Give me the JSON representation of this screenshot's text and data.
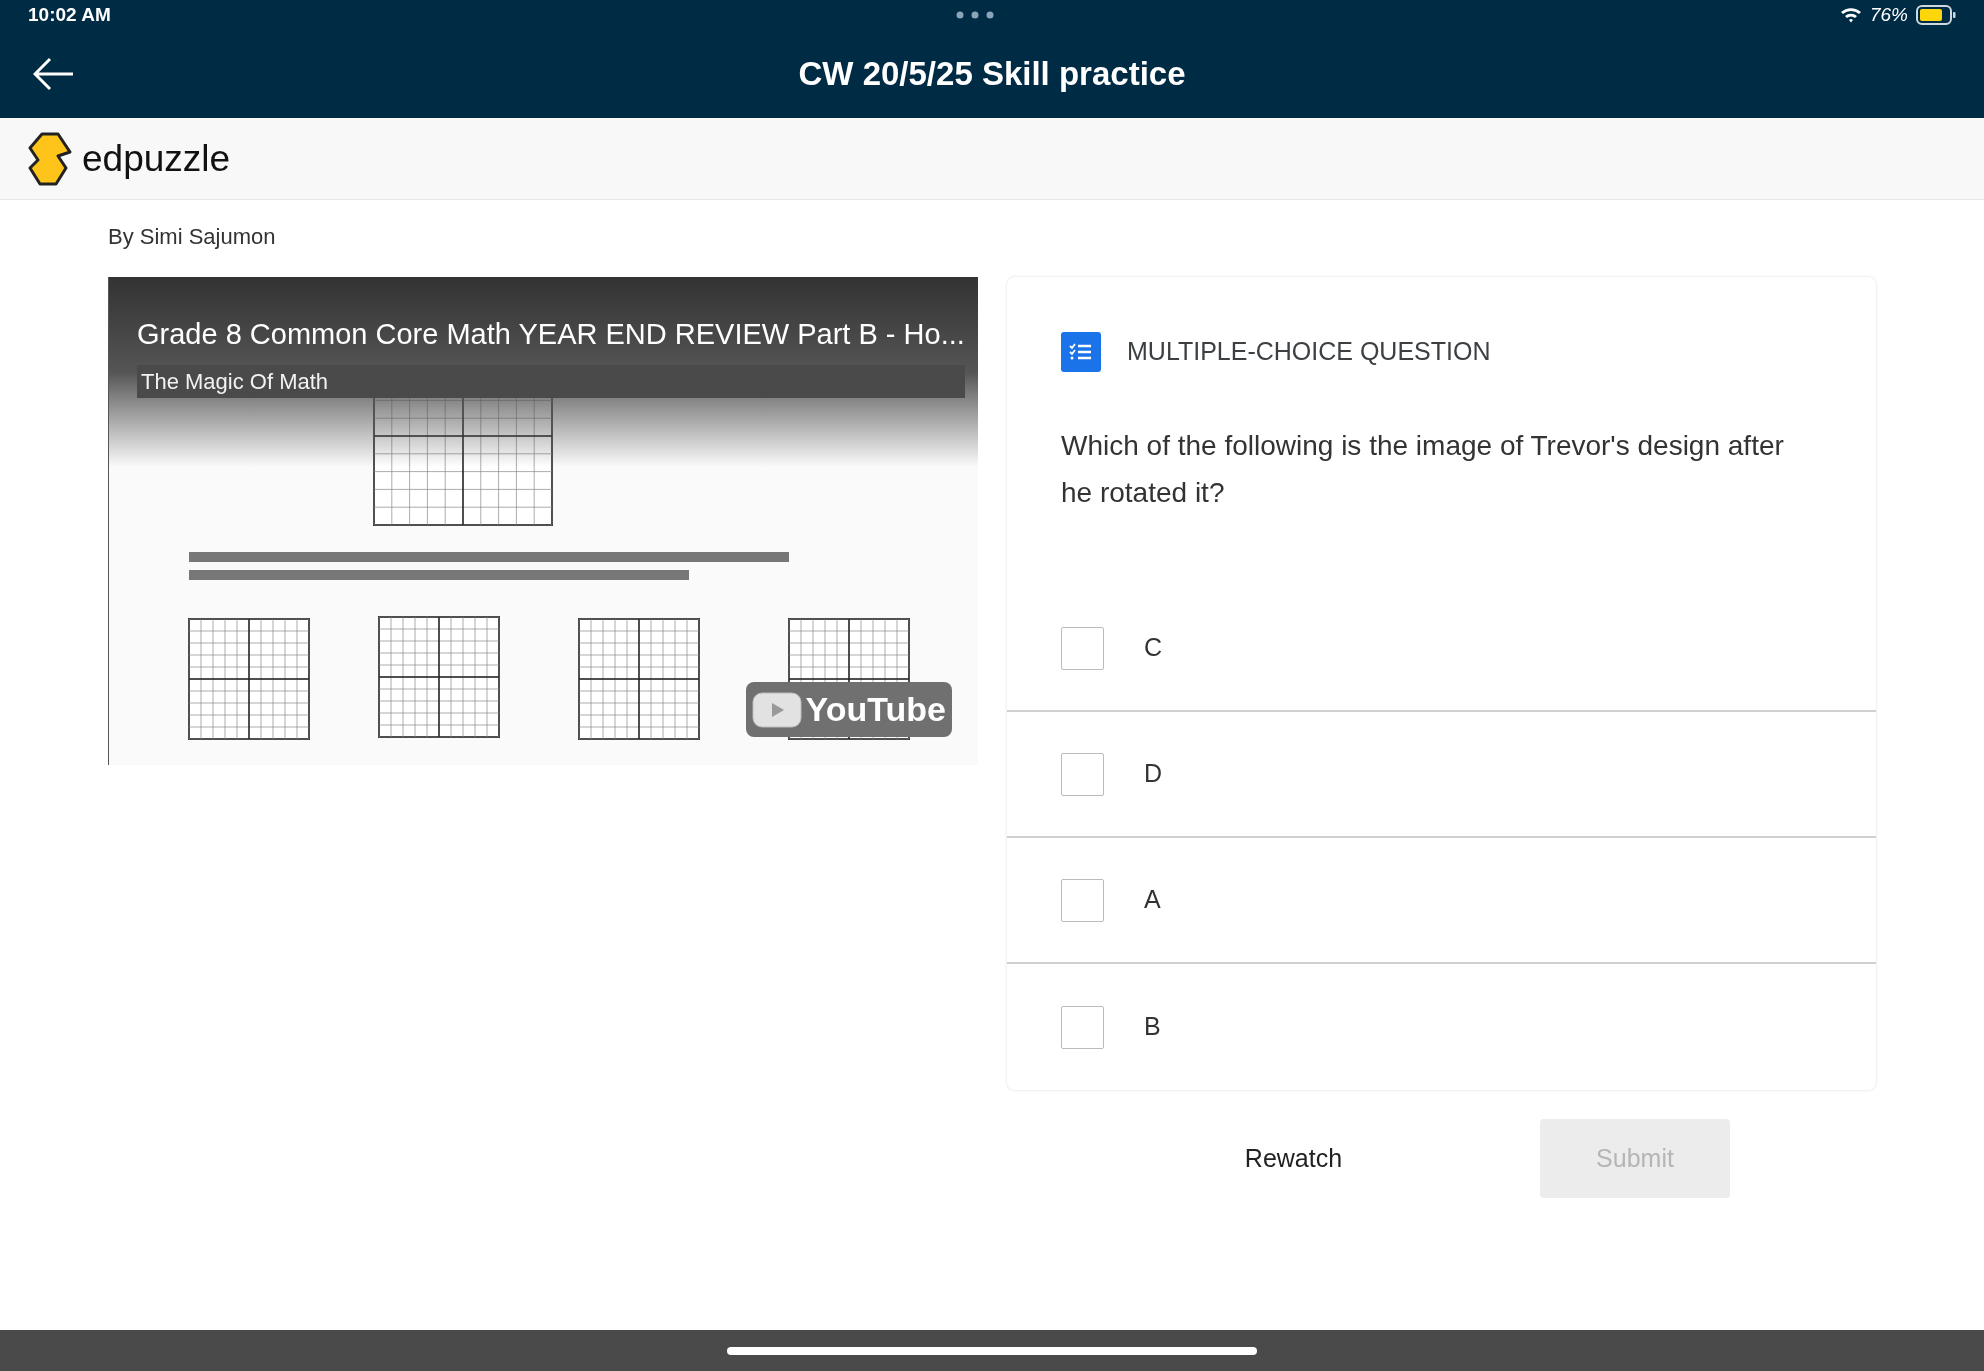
{
  "status_bar": {
    "time": "10:02 AM",
    "battery": "76%"
  },
  "header": {
    "title": "CW 20/5/25 Skill practice"
  },
  "brand": {
    "name": "edpuzzle"
  },
  "author": "By Simi Sajumon",
  "video": {
    "title": "Grade 8 Common Core Math YEAR END REVIEW Part B - Ho...",
    "channel": "The Magic Of Math",
    "logo_text": "YouTube"
  },
  "question": {
    "type_label": "MULTIPLE-CHOICE QUESTION",
    "text": "Which of the following is the image of Trevor's design after he rotated it?",
    "options": [
      {
        "label": "C",
        "checked": false
      },
      {
        "label": "D",
        "checked": false
      },
      {
        "label": "A",
        "checked": false
      },
      {
        "label": "B",
        "checked": false
      }
    ]
  },
  "actions": {
    "rewatch": "Rewatch",
    "submit": {
      "label": "Submit",
      "disabled": true
    }
  }
}
